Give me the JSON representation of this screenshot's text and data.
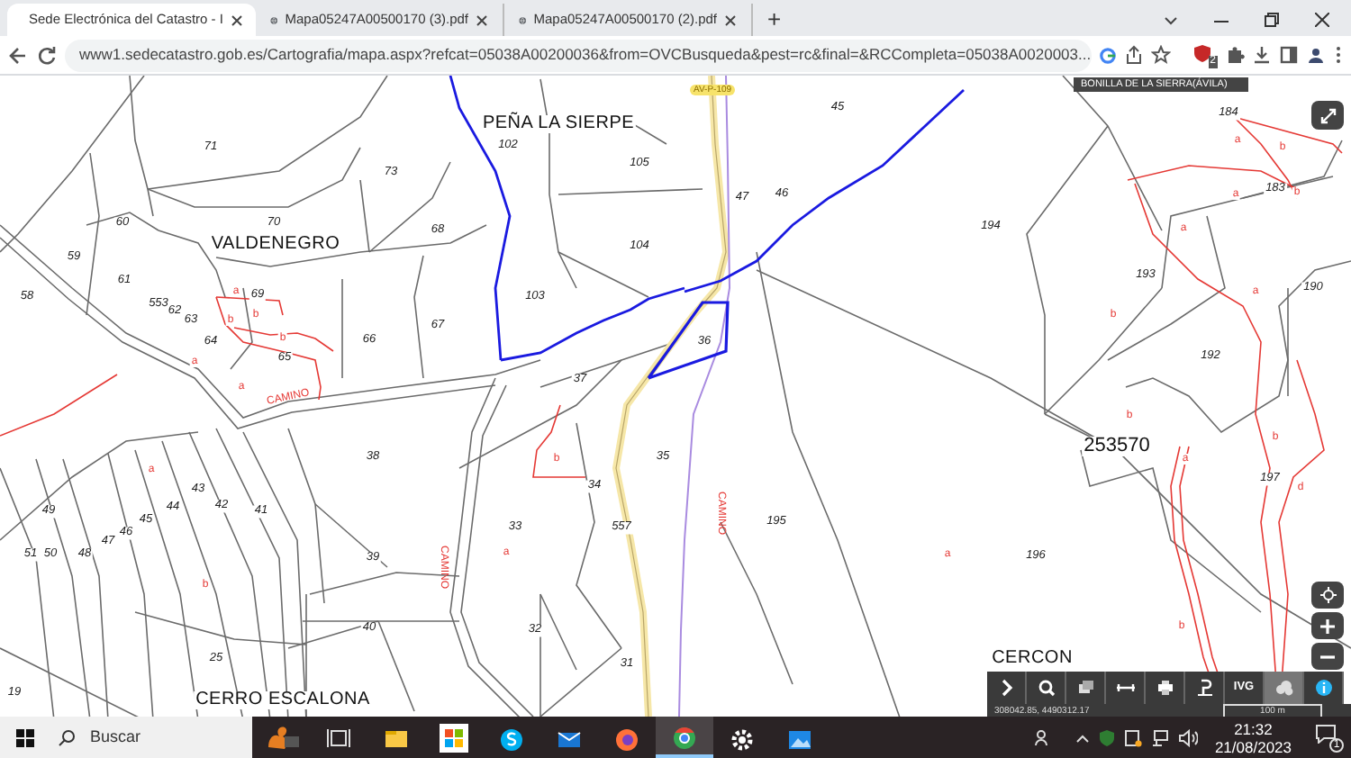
{
  "tabs": [
    {
      "title": "Sede Electrónica del Catastro - I",
      "selected": true,
      "kind": "site"
    },
    {
      "title": "Mapa05247A00500170 (3).pdf",
      "selected": false,
      "kind": "web"
    },
    {
      "title": "Mapa05247A00500170 (2).pdf",
      "selected": false,
      "kind": "web"
    }
  ],
  "new_tab": "+",
  "address": "www1.sedecatastro.gob.es/Cartografia/mapa.aspx?refcat=05038A00200036&from=OVCBusqueda&pest=rc&final=&RCCompleta=05038A0020003...",
  "extension_badge": "2",
  "map": {
    "municipality": "BONILLA DE LA SIERRA(ÁVILA)",
    "road_tag": "AV-P-109",
    "labels": [
      {
        "kind": "place",
        "text": "PEÑA LA SIERPE"
      },
      {
        "kind": "place",
        "text": "VALDENEGRO"
      },
      {
        "kind": "place",
        "text": "CERRO ESCALONA"
      },
      {
        "kind": "place",
        "text": "CERCON"
      },
      {
        "kind": "refcat",
        "text": "253570"
      },
      {
        "kind": "road",
        "text": "CAMINO"
      },
      {
        "kind": "road_vertical",
        "text": "CAMINO"
      },
      {
        "kind": "road_vertical",
        "text": "CAMINO"
      },
      {
        "kind": "parcel",
        "text": "71"
      },
      {
        "kind": "parcel",
        "text": "73"
      },
      {
        "kind": "parcel",
        "text": "60"
      },
      {
        "kind": "parcel",
        "text": "70"
      },
      {
        "kind": "parcel",
        "text": "68"
      },
      {
        "kind": "parcel",
        "text": "102"
      },
      {
        "kind": "parcel",
        "text": "105"
      },
      {
        "kind": "parcel",
        "text": "104"
      },
      {
        "kind": "parcel",
        "text": "59"
      },
      {
        "kind": "parcel",
        "text": "61"
      },
      {
        "kind": "parcel",
        "text": "58"
      },
      {
        "kind": "parcel",
        "text": "103"
      },
      {
        "kind": "parcel",
        "text": "553"
      },
      {
        "kind": "parcel",
        "text": "62"
      },
      {
        "kind": "parcel",
        "text": "63"
      },
      {
        "kind": "parcel",
        "text": "69"
      },
      {
        "kind": "parcel",
        "text": "66"
      },
      {
        "kind": "parcel",
        "text": "67"
      },
      {
        "kind": "parcel",
        "text": "64"
      },
      {
        "kind": "parcel",
        "text": "65"
      },
      {
        "kind": "parcel",
        "text": "37"
      },
      {
        "kind": "parcel",
        "text": "38"
      },
      {
        "kind": "parcel",
        "text": "35"
      },
      {
        "kind": "parcel",
        "text": "34"
      },
      {
        "kind": "parcel",
        "text": "33"
      },
      {
        "kind": "parcel",
        "text": "557"
      },
      {
        "kind": "parcel",
        "text": "43"
      },
      {
        "kind": "parcel",
        "text": "44"
      },
      {
        "kind": "parcel",
        "text": "42"
      },
      {
        "kind": "parcel",
        "text": "41"
      },
      {
        "kind": "parcel",
        "text": "45"
      },
      {
        "kind": "parcel",
        "text": "49"
      },
      {
        "kind": "parcel",
        "text": "46"
      },
      {
        "kind": "parcel",
        "text": "47"
      },
      {
        "kind": "parcel",
        "text": "51"
      },
      {
        "kind": "parcel",
        "text": "50"
      },
      {
        "kind": "parcel",
        "text": "48"
      },
      {
        "kind": "parcel",
        "text": "39"
      },
      {
        "kind": "parcel",
        "text": "40"
      },
      {
        "kind": "parcel",
        "text": "32"
      },
      {
        "kind": "parcel",
        "text": "25"
      },
      {
        "kind": "parcel",
        "text": "31"
      },
      {
        "kind": "parcel",
        "text": "19"
      },
      {
        "kind": "parcel",
        "text": "45"
      },
      {
        "kind": "parcel",
        "text": "47"
      },
      {
        "kind": "parcel",
        "text": "46"
      },
      {
        "kind": "parcel",
        "text": "194"
      },
      {
        "kind": "parcel",
        "text": "193"
      },
      {
        "kind": "parcel",
        "text": "190"
      },
      {
        "kind": "parcel",
        "text": "184"
      },
      {
        "kind": "parcel",
        "text": "183"
      },
      {
        "kind": "parcel",
        "text": "36"
      },
      {
        "kind": "parcel",
        "text": "192"
      },
      {
        "kind": "parcel",
        "text": "197"
      },
      {
        "kind": "parcel",
        "text": "195"
      },
      {
        "kind": "parcel",
        "text": "196"
      },
      {
        "kind": "subparcel",
        "text": "a"
      },
      {
        "kind": "subparcel",
        "text": "b"
      },
      {
        "kind": "subparcel",
        "text": "b"
      },
      {
        "kind": "subparcel",
        "text": "b"
      },
      {
        "kind": "subparcel",
        "text": "a"
      },
      {
        "kind": "subparcel",
        "text": "a"
      },
      {
        "kind": "subparcel",
        "text": "a"
      },
      {
        "kind": "subparcel",
        "text": "b"
      },
      {
        "kind": "subparcel",
        "text": "b"
      },
      {
        "kind": "subparcel",
        "text": "a"
      },
      {
        "kind": "subparcel",
        "text": "a"
      },
      {
        "kind": "subparcel",
        "text": "b"
      },
      {
        "kind": "subparcel",
        "text": "a"
      },
      {
        "kind": "subparcel",
        "text": "b"
      },
      {
        "kind": "subparcel",
        "text": "a"
      },
      {
        "kind": "subparcel",
        "text": "a"
      },
      {
        "kind": "subparcel",
        "text": "b"
      },
      {
        "kind": "subparcel",
        "text": "b"
      },
      {
        "kind": "subparcel",
        "text": "a"
      },
      {
        "kind": "subparcel",
        "text": "b"
      },
      {
        "kind": "subparcel",
        "text": "d"
      },
      {
        "kind": "subparcel",
        "text": "a"
      },
      {
        "kind": "subparcel",
        "text": "b"
      }
    ],
    "toolbar": [
      {
        "kind": "chevron"
      },
      {
        "kind": "search"
      },
      {
        "kind": "layers"
      },
      {
        "kind": "ruler"
      },
      {
        "kind": "print"
      },
      {
        "kind": "pin"
      },
      {
        "kind": "text",
        "text": "IVG"
      },
      {
        "kind": "clouds",
        "selected": true
      },
      {
        "kind": "info"
      }
    ],
    "coordinates": "308042.85, 4490312.17",
    "scale": "100 m"
  },
  "taskbar": {
    "search_placeholder": "Buscar",
    "apps": [
      {
        "kind": "squirrel",
        "selected": false
      },
      {
        "kind": "taskview",
        "selected": false
      },
      {
        "kind": "explorer",
        "selected": false
      },
      {
        "kind": "store",
        "selected": false
      },
      {
        "kind": "skype",
        "selected": false
      },
      {
        "kind": "mail",
        "selected": false
      },
      {
        "kind": "firefox",
        "selected": false
      },
      {
        "kind": "chrome",
        "selected": true
      },
      {
        "kind": "settings",
        "selected": false
      },
      {
        "kind": "photos",
        "selected": false
      }
    ],
    "time": "21:32",
    "date": "21/08/2023",
    "notifications": "1"
  }
}
